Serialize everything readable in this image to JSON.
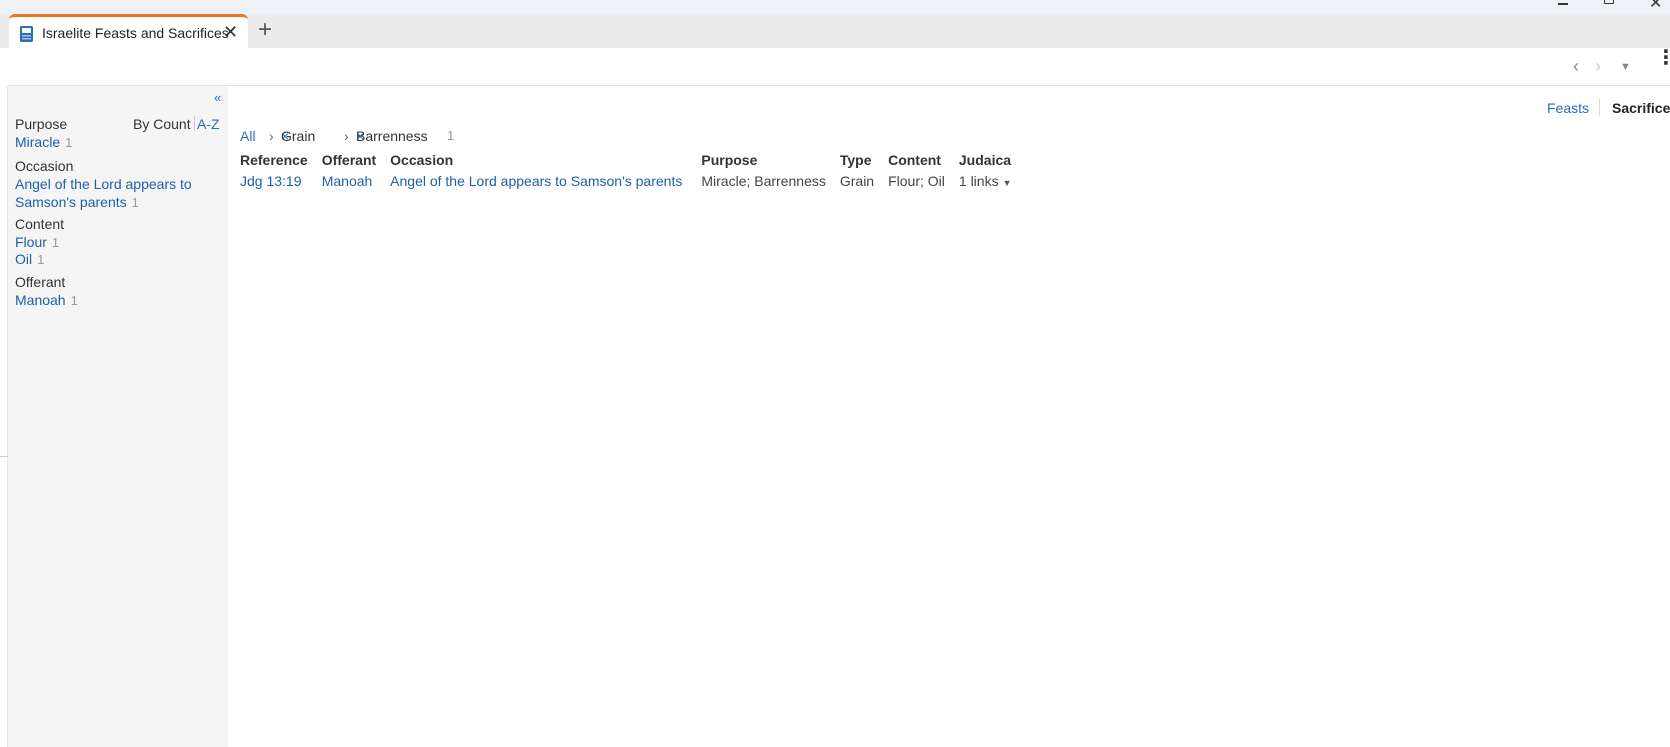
{
  "window": {
    "minimize_icon": "minimize-icon",
    "maximize_icon": "restore-icon",
    "close_icon": "close-icon",
    "close_glyph": "✕"
  },
  "tab": {
    "title": "Israelite Feasts and Sacrifices",
    "close_glyph": "✕",
    "new_glyph": "+",
    "accent_color": "#e87722"
  },
  "toolbar": {
    "back_glyph": "‹",
    "forward_glyph": "›",
    "dropdown_glyph": "▼",
    "more_glyph": "⋮"
  },
  "sidebar": {
    "collapse_glyph": "«",
    "sort_by_count": "By Count",
    "sort_az": "A-Z",
    "facets": [
      {
        "header": "Purpose",
        "items": [
          {
            "label": "Miracle",
            "count": "1"
          }
        ]
      },
      {
        "header": "Occasion",
        "items": [
          {
            "label_line1": "Angel of the Lord appears to",
            "label_line2": "Samson's parents",
            "count": "1"
          }
        ]
      },
      {
        "header": "Content",
        "items": [
          {
            "label": "Flour",
            "count": "1"
          },
          {
            "label": "Oil",
            "count": "1"
          }
        ]
      },
      {
        "header": "Offerant",
        "items": [
          {
            "label": "Manoah",
            "count": "1"
          }
        ]
      }
    ]
  },
  "views": {
    "feasts": "Feasts",
    "sacrifices": "Sacrifices"
  },
  "breadcrumb": {
    "all": "All",
    "sep": "›",
    "remove": "×",
    "filter1": "Grain",
    "filter2": "Barrenness",
    "count": "1"
  },
  "table": {
    "columns": [
      "Reference",
      "Offerant",
      "Occasion",
      "Purpose",
      "Type",
      "Content",
      "Judaica"
    ],
    "rows": [
      {
        "reference": "Jdg 13:19",
        "offerant": "Manoah",
        "occasion": "Angel of the Lord appears to Samson's parents",
        "purpose": "Miracle; Barrenness",
        "type": "Grain",
        "content": "Flour; Oil",
        "judaica": "1 links"
      }
    ]
  },
  "colors": {
    "link": "#1f5fa8",
    "sidebar_bg": "#f5f5f5"
  }
}
